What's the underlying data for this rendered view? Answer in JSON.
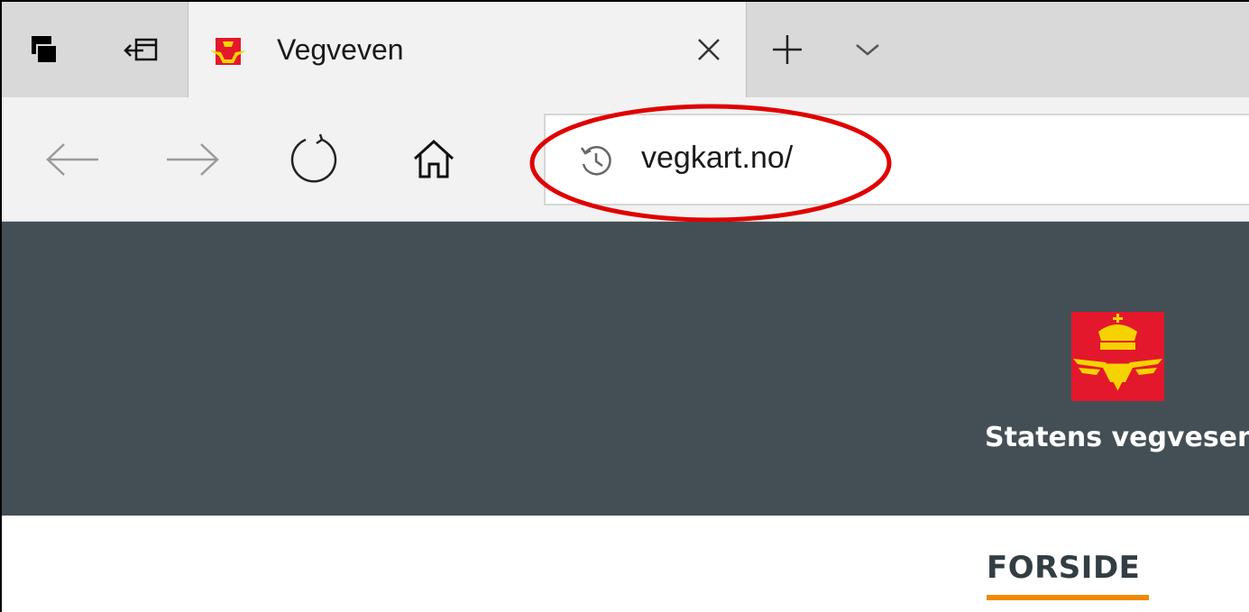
{
  "browser": {
    "tab": {
      "title": "Vegveven",
      "favicon": "statens-vegvesen-emblem"
    },
    "tab_controls": {
      "new_tab": "+",
      "tab_list": "chevron-down"
    },
    "address": {
      "url": "vegkart.no/"
    }
  },
  "site": {
    "brand": "Statens vegvesen",
    "nav": {
      "active_item": "FORSIDE"
    }
  },
  "colors": {
    "header_bg": "#444f55",
    "accent": "#f08a00",
    "annotation": "#e00000",
    "logo_red": "#e3182d",
    "logo_gold": "#f5d300"
  }
}
